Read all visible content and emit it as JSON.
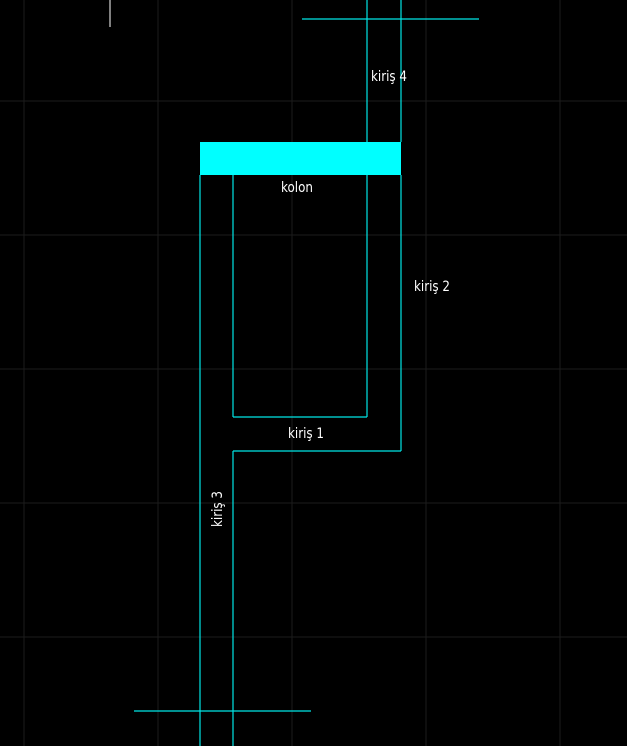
{
  "colors": {
    "background": "#000000",
    "grid": "#1c1c1c",
    "beam_line": "#00e5e5",
    "column_fill": "#00ffff",
    "text": "#ffffff",
    "cursor": "#ffffff"
  },
  "labels": {
    "kolon": "kolon",
    "kiris_1": "kiriş 1",
    "kiris_2": "kiriş 2",
    "kiris_3": "kiriş 3",
    "kiris_4": "kiriş 4"
  }
}
